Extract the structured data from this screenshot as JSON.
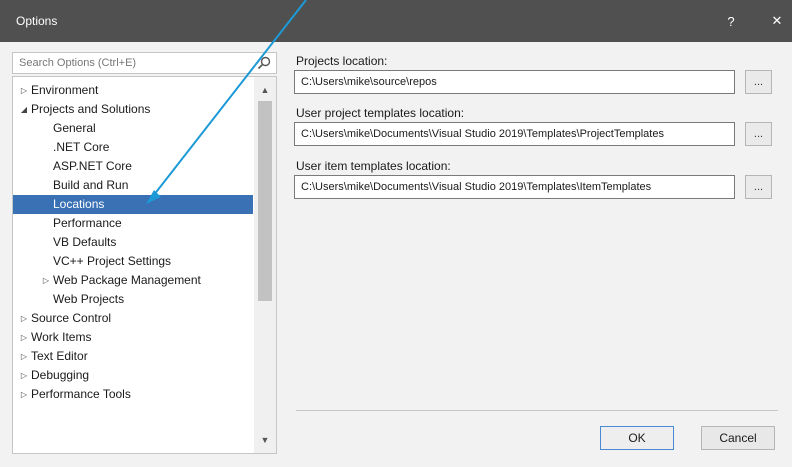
{
  "window": {
    "title": "Options",
    "help": "?",
    "close": "✕"
  },
  "search": {
    "placeholder": "Search Options (Ctrl+E)"
  },
  "tree": {
    "items": [
      {
        "label": "Environment",
        "arrow": "▷"
      },
      {
        "label": "Projects and Solutions",
        "arrow": "◢"
      },
      {
        "label": "General"
      },
      {
        "label": ".NET Core"
      },
      {
        "label": "ASP.NET Core"
      },
      {
        "label": "Build and Run"
      },
      {
        "label": "Locations",
        "selected": true
      },
      {
        "label": "Performance"
      },
      {
        "label": "VB Defaults"
      },
      {
        "label": "VC++ Project Settings"
      },
      {
        "label": "Web Package Management",
        "arrow": "▷"
      },
      {
        "label": "Web Projects"
      },
      {
        "label": "Source Control",
        "arrow": "▷"
      },
      {
        "label": "Work Items",
        "arrow": "▷"
      },
      {
        "label": "Text Editor",
        "arrow": "▷"
      },
      {
        "label": "Debugging",
        "arrow": "▷"
      },
      {
        "label": "Performance Tools",
        "arrow": "▷"
      }
    ],
    "scroll_up": "▲",
    "scroll_down": "▼"
  },
  "settings": {
    "projects_location": {
      "label": "Projects location:",
      "value": "C:\\Users\\mike\\source\\repos",
      "browse": "..."
    },
    "user_project_templates": {
      "label": "User project templates location:",
      "value": "C:\\Users\\mike\\Documents\\Visual Studio 2019\\Templates\\ProjectTemplates",
      "browse": "..."
    },
    "user_item_templates": {
      "label": "User item templates location:",
      "value": "C:\\Users\\mike\\Documents\\Visual Studio 2019\\Templates\\ItemTemplates",
      "browse": "..."
    }
  },
  "buttons": {
    "ok": "OK",
    "cancel": "Cancel"
  },
  "colors": {
    "titlebar": "#505050",
    "selection": "#3a70b4",
    "annotation": "#1c9ad6"
  }
}
